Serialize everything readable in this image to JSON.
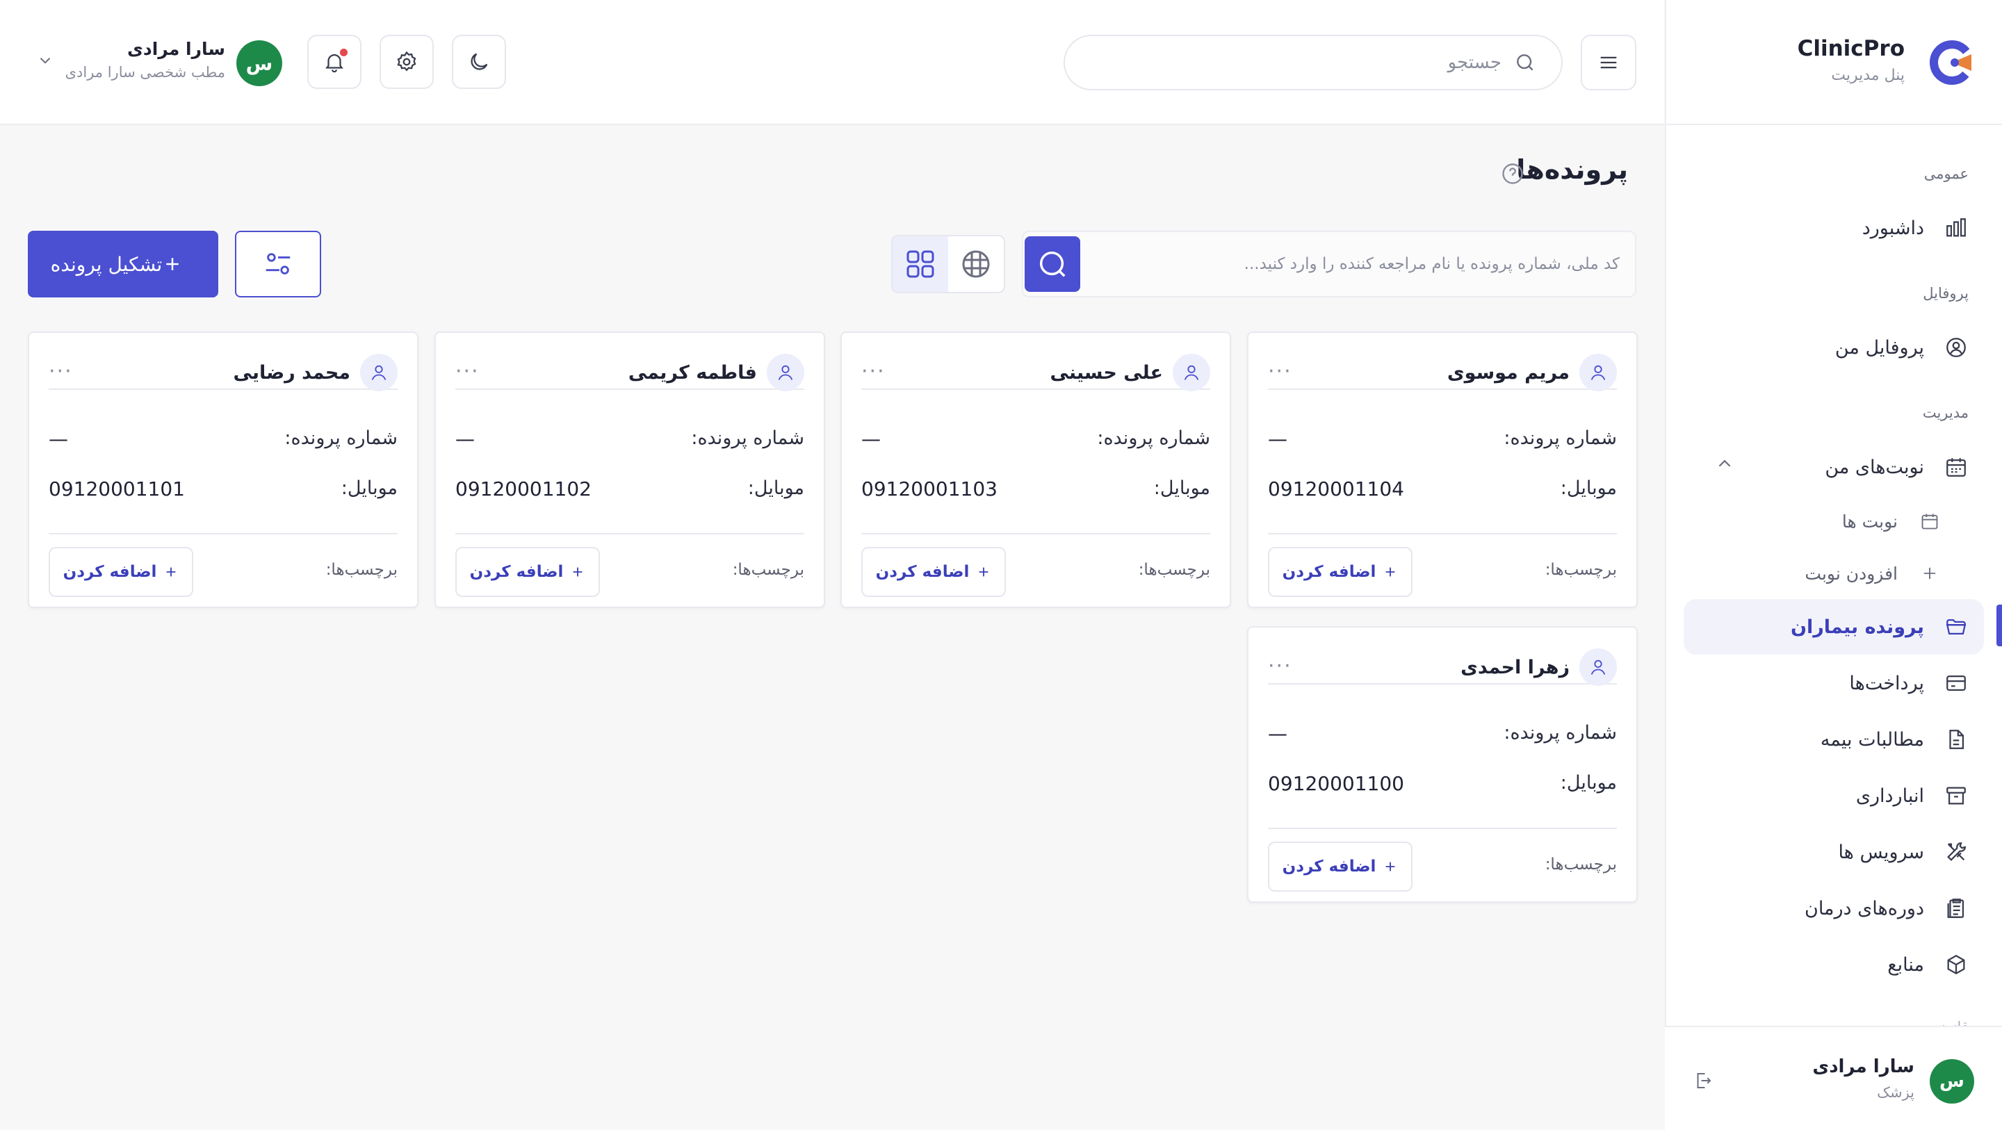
{
  "brand": {
    "name": "ClinicPro",
    "subtitle": "پنل مدیریت"
  },
  "header": {
    "search_placeholder": "جستجو",
    "user": {
      "initial": "س",
      "name": "سارا مرادی",
      "subtitle": "مطب شخصی سارا مرادی"
    }
  },
  "sidebar": {
    "sections": {
      "general": "عمومی",
      "profile": "پروفایل",
      "management": "مدیریت",
      "cut": "قانونی"
    },
    "items": {
      "dashboard": "داشبورد",
      "my_profile": "پروفایل من",
      "my_appointments": "نوبت‌های من",
      "appointments": "نوبت ها",
      "add_appointment": "افزودن نوبت",
      "patient_files": "پرونده بیماران",
      "payments": "پرداخت‌ها",
      "insurance": "مطالبات بیمه",
      "warehouse": "انبارداری",
      "services": "سرویس ها",
      "treatment_courses": "دوره‌های درمان",
      "resources": "منابع"
    },
    "footer": {
      "initial": "س",
      "name": "سارا مرادی",
      "role": "پزشک"
    }
  },
  "main": {
    "title": "پرونده‌ها",
    "search_placeholder": "کد ملی، شماره پرونده یا نام مراجعه کننده را وارد کنید...",
    "create_button": "تشکیل پرونده",
    "labels": {
      "file_number": "شماره پرونده:",
      "mobile": "موبایل:",
      "tags": "برچسب‌ها:",
      "add": "اضافه کردن",
      "more": "···"
    },
    "cards": [
      {
        "name": "مریم موسوی",
        "file_number": "—",
        "mobile": "09120001104"
      },
      {
        "name": "علی حسینی",
        "file_number": "—",
        "mobile": "09120001103"
      },
      {
        "name": "فاطمه کریمی",
        "file_number": "—",
        "mobile": "09120001102"
      },
      {
        "name": "محمد رضایی",
        "file_number": "—",
        "mobile": "09120001101"
      },
      {
        "name": "زهرا احمدی",
        "file_number": "—",
        "mobile": "09120001100"
      }
    ]
  },
  "colors": {
    "accent": "#4b4fd1",
    "avatar_green": "#1e8a4a",
    "notification_dot": "#e5484d"
  }
}
